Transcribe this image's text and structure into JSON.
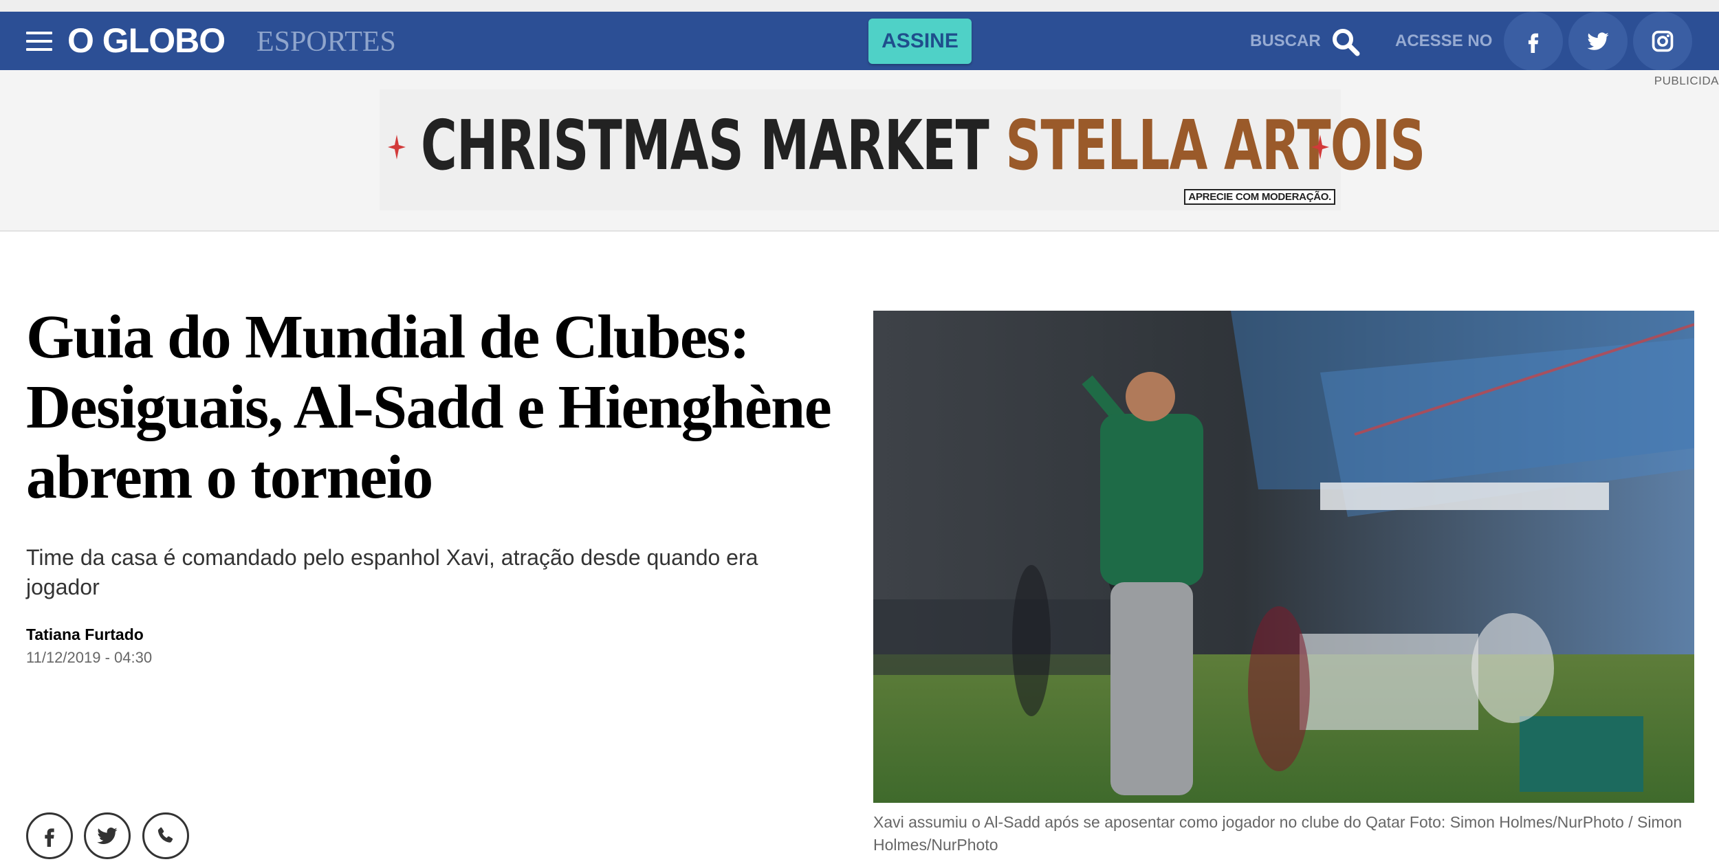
{
  "header": {
    "menu_icon": "hamburger-menu-icon",
    "logo": "O GLOBO",
    "section": "ESPORTES",
    "subscribe_label": "ASSINE",
    "search_label": "BUSCAR",
    "search_icon": "search-icon",
    "access_label": "ACESSE NO",
    "social": [
      {
        "name": "facebook",
        "icon": "facebook-icon"
      },
      {
        "name": "twitter",
        "icon": "twitter-icon"
      },
      {
        "name": "instagram",
        "icon": "instagram-icon"
      }
    ],
    "colors": {
      "navbar": "#2c4f95",
      "subscribe_bg": "#4fd1c7",
      "subscribe_text": "#1f4e8c"
    }
  },
  "ad": {
    "label": "PUBLICIDA",
    "banner_part1": "CHRISTMAS MARKET",
    "banner_part2": "STELLA ARTOIS",
    "disclaimer": "APRECIE COM MODERAÇÃO."
  },
  "article": {
    "title": "Guia do Mundial de Clubes: Desiguais, Al-Sadd e Hienghène abrem o torneio",
    "subtitle": "Time da casa é comandado pelo espanhol Xavi, atração desde quando era jogador",
    "author": "Tatiana Furtado",
    "date": "11/12/2019 - 04:30",
    "share": [
      {
        "name": "facebook",
        "icon": "facebook-icon"
      },
      {
        "name": "twitter",
        "icon": "twitter-icon"
      },
      {
        "name": "whatsapp",
        "icon": "whatsapp-icon"
      }
    ],
    "photo_caption": "Xavi assumiu o Al-Sadd após se aposentar como jogador no clube do Qatar Foto: Simon Holmes/NurPhoto / Simon Holmes/NurPhoto"
  }
}
